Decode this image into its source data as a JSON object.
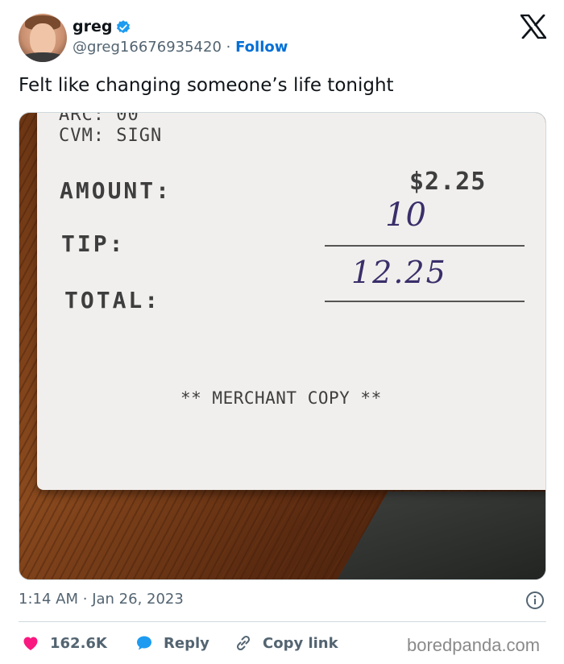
{
  "author": {
    "name": "greg",
    "handle": "@greg16676935420",
    "separator": "·",
    "follow_label": "Follow"
  },
  "icons": {
    "verified": "verified-badge-icon",
    "logo": "x-logo-icon",
    "info": "info-icon",
    "like": "heart-icon",
    "reply": "speech-bubble-icon",
    "copy": "link-icon"
  },
  "tweet": {
    "text": "Felt like changing someone’s life tonight"
  },
  "receipt": {
    "arc_line": "ARC: 00",
    "cvm_line": "CVM: SIGN",
    "amount_label": "AMOUNT:",
    "amount_value": "$2.25",
    "tip_label": "TIP:",
    "tip_handwritten": "10",
    "total_label": "TOTAL:",
    "total_handwritten": "12.25",
    "footer": "** MERCHANT COPY **"
  },
  "meta": {
    "time": "1:14 AM",
    "separator": "·",
    "date": "Jan 26, 2023"
  },
  "actions": {
    "like_count": "162.6K",
    "reply_label": "Reply",
    "copy_label": "Copy link"
  },
  "watermark": "boredpanda.com",
  "colors": {
    "accent_blue": "#006fd6",
    "verified_blue": "#1d9bf0",
    "like_pink": "#f91880",
    "reply_blue": "#1d9bf0",
    "text_secondary": "#536471"
  }
}
